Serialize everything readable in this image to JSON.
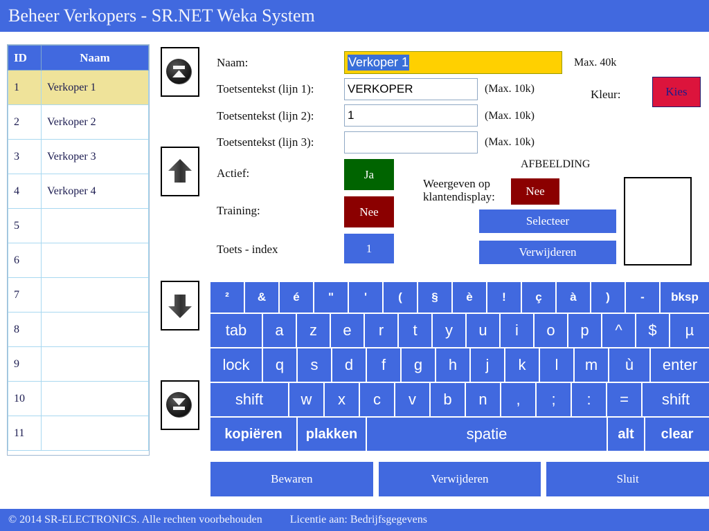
{
  "window": {
    "title": "Beheer Verkopers - SR.NET Weka System",
    "title_bar_color": "#4169DF"
  },
  "grid": {
    "columns": [
      "ID",
      "Naam"
    ],
    "selected_row_index": 0,
    "selected_row_color": "#EFE39A",
    "rows": [
      {
        "id": "1",
        "naam": "Verkoper 1"
      },
      {
        "id": "2",
        "naam": "Verkoper 2"
      },
      {
        "id": "3",
        "naam": "Verkoper 3"
      },
      {
        "id": "4",
        "naam": "Verkoper 4"
      },
      {
        "id": "5",
        "naam": ""
      },
      {
        "id": "6",
        "naam": ""
      },
      {
        "id": "7",
        "naam": ""
      },
      {
        "id": "8",
        "naam": ""
      },
      {
        "id": "9",
        "naam": ""
      },
      {
        "id": "10",
        "naam": ""
      },
      {
        "id": "11",
        "naam": ""
      }
    ]
  },
  "navigation": {
    "first": "first-record-icon",
    "previous": "up-arrow-icon",
    "next": "down-arrow-icon",
    "last": "last-record-icon"
  },
  "form": {
    "naam_label": "Naam:",
    "naam_value": "Verkoper 1",
    "naam_max_note": "Max. 40k",
    "naam_field_color": "#FFD000",
    "line1_label": "Toetsentekst (lijn 1):",
    "line1_value": "VERKOPER",
    "line1_max_note": "(Max. 10k)",
    "line2_label": "Toetsentekst (lijn 2):",
    "line2_value": "1",
    "line2_max_note": "(Max. 10k)",
    "line3_label": "Toetsentekst (lijn 3):",
    "line3_value": "",
    "line3_max_note": "(Max. 10k)",
    "actief_label": "Actief:",
    "actief_value": "Ja",
    "actief_color": "#006400",
    "training_label": "Training:",
    "training_value": "Nee",
    "training_color": "#8B0000",
    "toets_index_label": "Toets - index",
    "toets_index_value": "1",
    "kleur_label": "Kleur:",
    "kleur_button": "Kies",
    "kleur_color": "#DC143C"
  },
  "image_panel": {
    "title": "AFBEELDING",
    "klantendisplay_label": "Weergeven op klantendisplay:",
    "klantendisplay_value": "Nee",
    "klantendisplay_color": "#8B0000",
    "select_button": "Selecteer",
    "delete_button": "Verwijderen",
    "preview_placeholder": ""
  },
  "keyboard": {
    "row1": [
      "²",
      "&",
      "é",
      "\"",
      "'",
      "(",
      "§",
      "è",
      "!",
      "ç",
      "à",
      ")",
      "-",
      "bksp"
    ],
    "row2": [
      "tab",
      "a",
      "z",
      "e",
      "r",
      "t",
      "y",
      "u",
      "i",
      "o",
      "p",
      "^",
      "$",
      "µ"
    ],
    "row3": [
      "lock",
      "q",
      "s",
      "d",
      "f",
      "g",
      "h",
      "j",
      "k",
      "l",
      "m",
      "ù",
      "enter"
    ],
    "row4": [
      "shift",
      "w",
      "x",
      "c",
      "v",
      "b",
      "n",
      ",",
      ";",
      ":",
      "=",
      "shift"
    ],
    "row5": [
      "kopiëren",
      "plakken",
      "spatie",
      "alt",
      "clear"
    ]
  },
  "actions": {
    "save": "Bewaren",
    "delete": "Verwijderen",
    "close": "Sluit"
  },
  "status": {
    "copyright": "© 2014 SR-ELECTRONICS. Alle rechten voorbehouden",
    "license": "Licentie aan: Bedrijfsgegevens"
  }
}
